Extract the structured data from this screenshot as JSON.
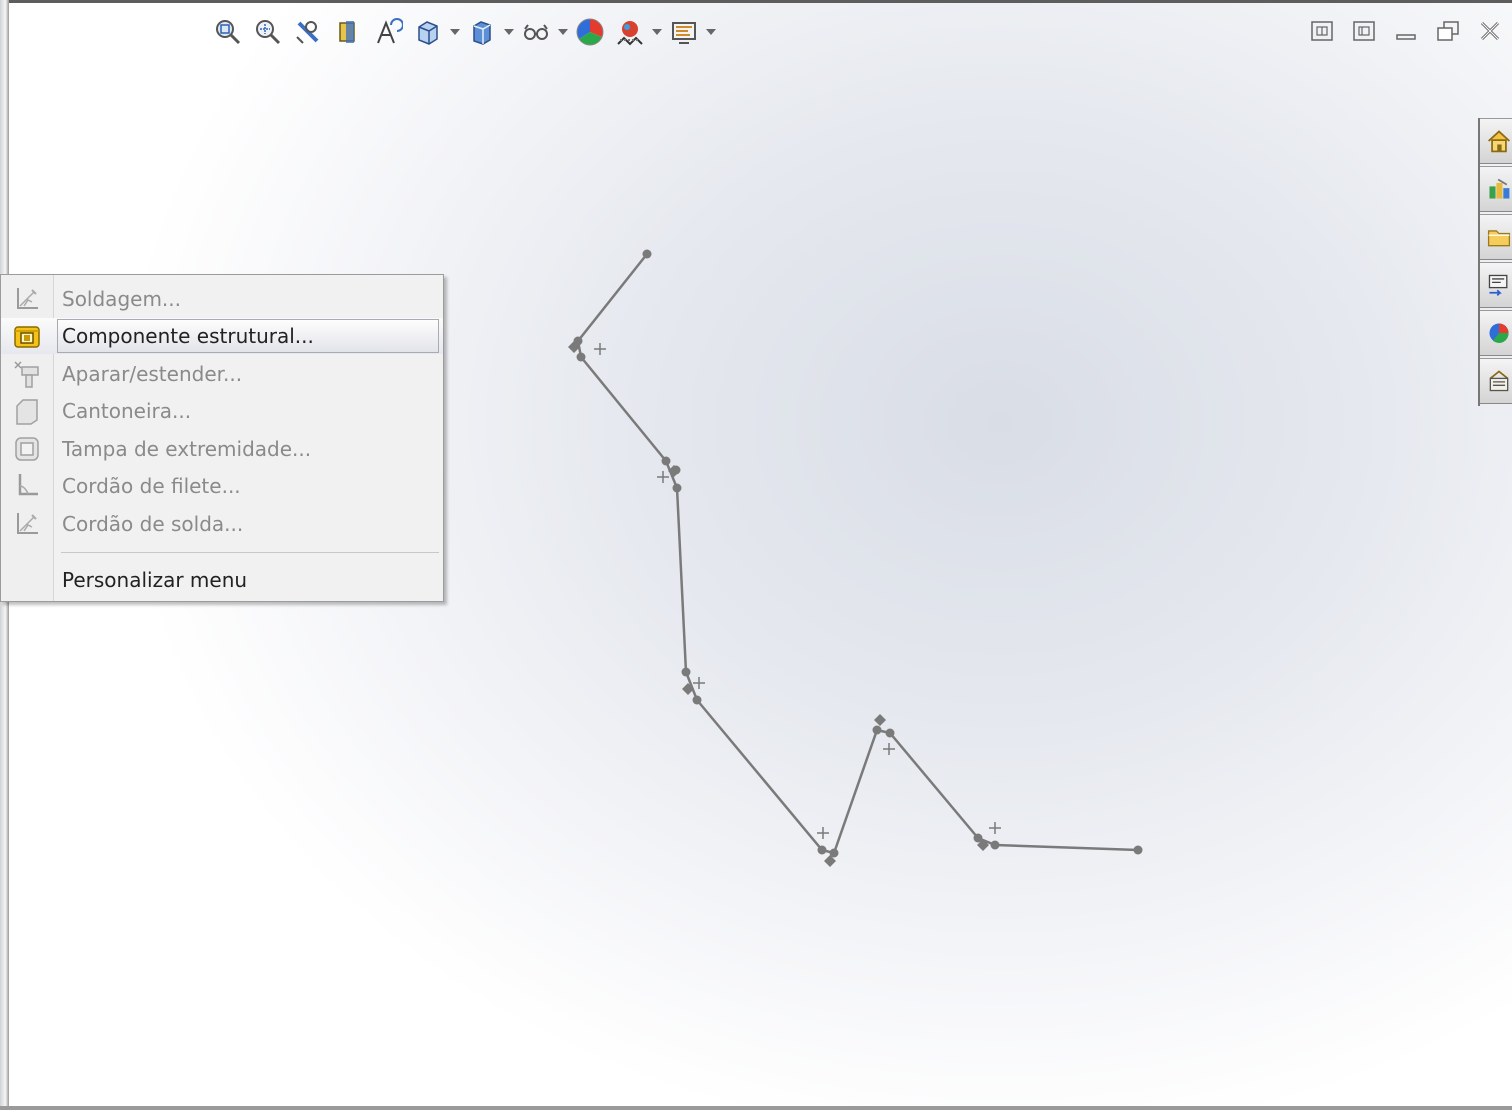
{
  "toolbar": {
    "buttons": [
      {
        "icon": "zoom-to-fit-icon"
      },
      {
        "icon": "zoom-to-area-icon"
      },
      {
        "icon": "previous-view-icon"
      },
      {
        "icon": "section-view-icon"
      },
      {
        "icon": "dynamic-annotation-icon"
      },
      {
        "icon": "view-orientation-icon",
        "dropdown": true
      },
      {
        "icon": "display-style-icon",
        "dropdown": true
      },
      {
        "icon": "hide-show-items-icon",
        "dropdown": true
      },
      {
        "icon": "edit-appearance-icon"
      },
      {
        "icon": "apply-scene-icon",
        "dropdown": true
      },
      {
        "icon": "view-settings-icon",
        "dropdown": true
      }
    ]
  },
  "window_controls": [
    "split-vertical-icon",
    "split-horizontal-icon",
    "minimize-icon",
    "restore-icon",
    "close-icon"
  ],
  "task_pane": [
    "solidworks-resources-icon",
    "design-library-icon",
    "file-explorer-icon",
    "view-palette-icon",
    "appearances-scenes-icon",
    "custom-properties-icon"
  ],
  "context_menu": {
    "items": [
      {
        "label": "Soldagem...",
        "enabled": false,
        "icon": "weldment-icon"
      },
      {
        "label": "Componente estrutural...",
        "enabled": true,
        "highlighted": true,
        "icon": "structural-member-icon"
      },
      {
        "label": "Aparar/estender...",
        "enabled": false,
        "icon": "trim-extend-icon"
      },
      {
        "label": "Cantoneira...",
        "enabled": false,
        "icon": "gusset-icon"
      },
      {
        "label": "Tampa de extremidade...",
        "enabled": false,
        "icon": "end-cap-icon"
      },
      {
        "label": "Cordão de filete...",
        "enabled": false,
        "icon": "fillet-bead-icon"
      },
      {
        "label": "Cordão de solda...",
        "enabled": false,
        "icon": "weld-bead-icon"
      }
    ],
    "customize_label": "Personalizar menu"
  },
  "colors": {
    "sketch_line": "#7a7a7a",
    "menu_background": "#f1f1f1",
    "highlight_icon": "#f2b400"
  }
}
